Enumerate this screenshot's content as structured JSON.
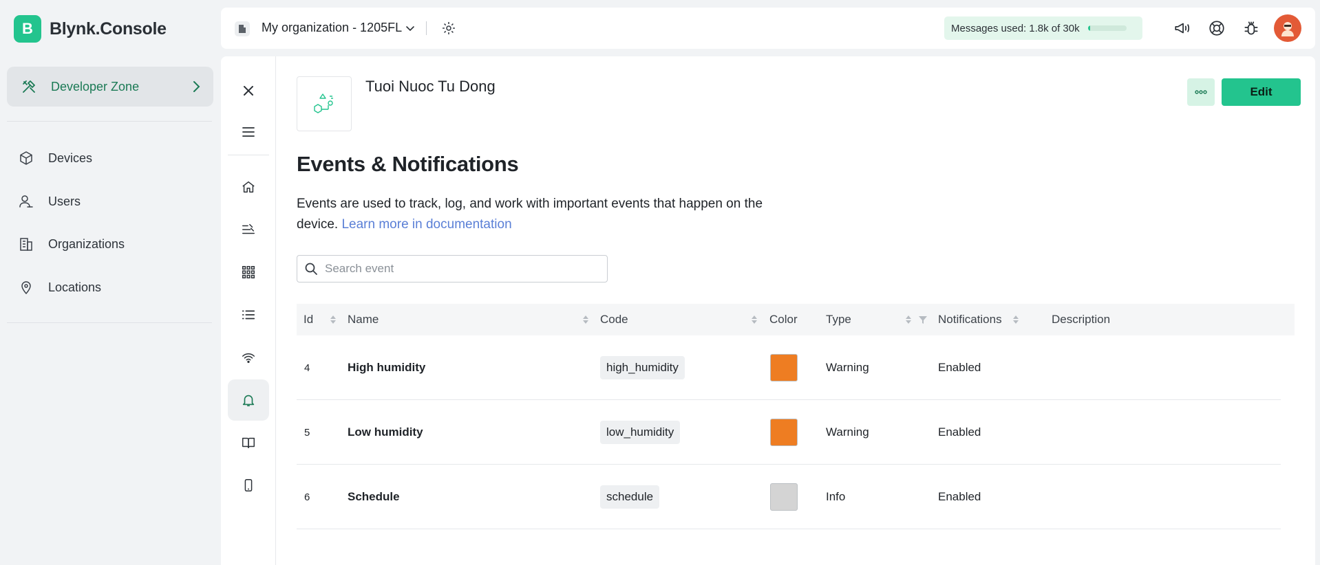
{
  "brand": {
    "logo_letter": "B",
    "name": "Blynk.Console"
  },
  "sidebar": {
    "developer_zone": "Developer Zone",
    "items": [
      {
        "label": "Devices",
        "icon": "cube-icon"
      },
      {
        "label": "Users",
        "icon": "users-icon"
      },
      {
        "label": "Organizations",
        "icon": "building-icon"
      },
      {
        "label": "Locations",
        "icon": "location-pin-icon"
      }
    ]
  },
  "topbar": {
    "organization": "My organization - 1205FL",
    "messages_label": "Messages used:",
    "messages_value": "1.8k of 30k",
    "messages_progress": 0.06
  },
  "template": {
    "name": "Tuoi Nuoc Tu Dong"
  },
  "actions": {
    "more": "•••",
    "edit": "Edit"
  },
  "page": {
    "title": "Events & Notifications",
    "description": "Events are used to track, log, and work with important events that happen on the device.",
    "doc_link": "Learn more in documentation"
  },
  "search": {
    "placeholder": "Search event",
    "value": ""
  },
  "table": {
    "columns": {
      "id": "Id",
      "name": "Name",
      "code": "Code",
      "color": "Color",
      "type": "Type",
      "notifications": "Notifications",
      "description": "Description"
    },
    "rows": [
      {
        "id": "4",
        "name": "High humidity",
        "code": "high_humidity",
        "color": "#ee7d22",
        "type": "Warning",
        "notifications": "Enabled",
        "description": ""
      },
      {
        "id": "5",
        "name": "Low humidity",
        "code": "low_humidity",
        "color": "#ee7d22",
        "type": "Warning",
        "notifications": "Enabled",
        "description": ""
      },
      {
        "id": "6",
        "name": "Schedule",
        "code": "schedule",
        "color": "#d4d4d4",
        "type": "Info",
        "notifications": "Enabled",
        "description": ""
      }
    ]
  },
  "colors": {
    "accent": "#23c48e",
    "link": "#5a7fd6",
    "dev_zone_text": "#1b7a55"
  }
}
